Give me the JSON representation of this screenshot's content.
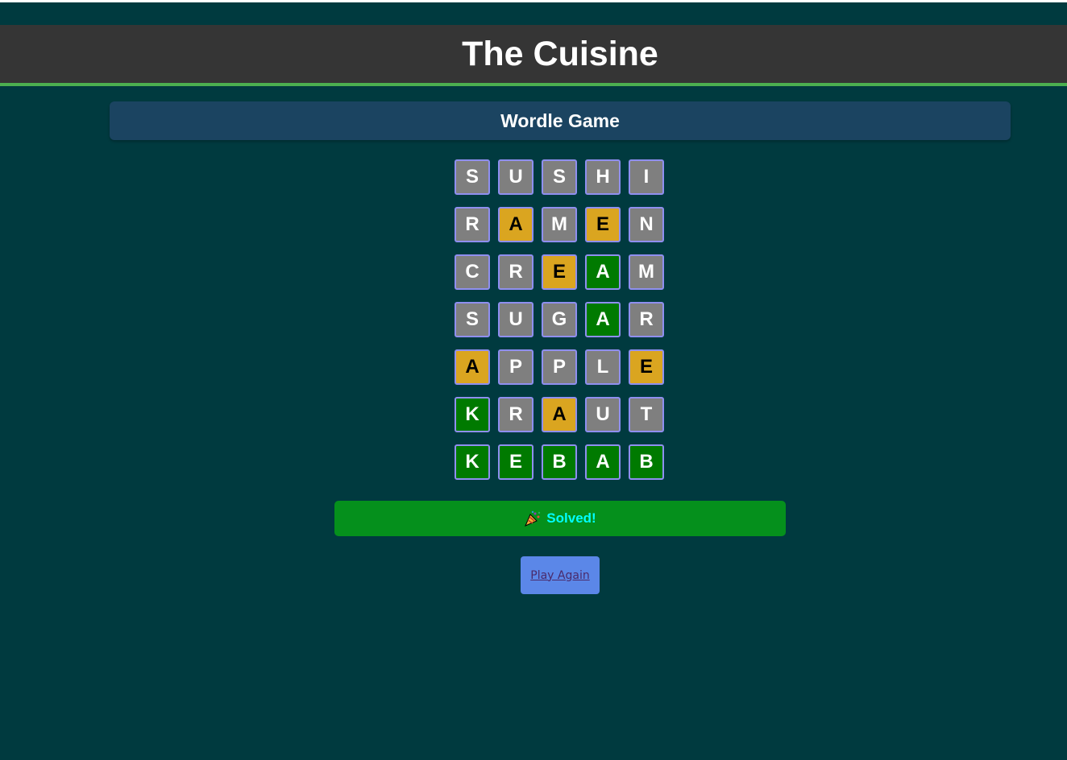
{
  "header": {
    "title": "The Cuisine"
  },
  "subheader": {
    "title": "Wordle Game"
  },
  "board": {
    "rows": [
      [
        {
          "letter": "S",
          "state": "absent"
        },
        {
          "letter": "U",
          "state": "absent"
        },
        {
          "letter": "S",
          "state": "absent"
        },
        {
          "letter": "H",
          "state": "absent"
        },
        {
          "letter": "I",
          "state": "absent"
        }
      ],
      [
        {
          "letter": "R",
          "state": "absent"
        },
        {
          "letter": "A",
          "state": "present"
        },
        {
          "letter": "M",
          "state": "absent"
        },
        {
          "letter": "E",
          "state": "present"
        },
        {
          "letter": "N",
          "state": "absent"
        }
      ],
      [
        {
          "letter": "C",
          "state": "absent"
        },
        {
          "letter": "R",
          "state": "absent"
        },
        {
          "letter": "E",
          "state": "present"
        },
        {
          "letter": "A",
          "state": "correct"
        },
        {
          "letter": "M",
          "state": "absent"
        }
      ],
      [
        {
          "letter": "S",
          "state": "absent"
        },
        {
          "letter": "U",
          "state": "absent"
        },
        {
          "letter": "G",
          "state": "absent"
        },
        {
          "letter": "A",
          "state": "correct"
        },
        {
          "letter": "R",
          "state": "absent"
        }
      ],
      [
        {
          "letter": "A",
          "state": "present"
        },
        {
          "letter": "P",
          "state": "absent"
        },
        {
          "letter": "P",
          "state": "absent"
        },
        {
          "letter": "L",
          "state": "absent"
        },
        {
          "letter": "E",
          "state": "present"
        }
      ],
      [
        {
          "letter": "K",
          "state": "correct"
        },
        {
          "letter": "R",
          "state": "absent"
        },
        {
          "letter": "A",
          "state": "present"
        },
        {
          "letter": "U",
          "state": "absent"
        },
        {
          "letter": "T",
          "state": "absent"
        }
      ],
      [
        {
          "letter": "K",
          "state": "correct"
        },
        {
          "letter": "E",
          "state": "correct"
        },
        {
          "letter": "B",
          "state": "correct"
        },
        {
          "letter": "A",
          "state": "correct"
        },
        {
          "letter": "B",
          "state": "correct"
        }
      ]
    ]
  },
  "status": {
    "icon": "party-popper-icon",
    "text": "Solved!"
  },
  "actions": {
    "play_again_label": "Play Again"
  },
  "colors": {
    "background": "#003a3f",
    "header_bg": "#353535",
    "header_accent": "#4caf50",
    "subheader_bg": "#1b4461",
    "absent": "#7f7f7f",
    "present": "#daa520",
    "correct": "#007a00",
    "status_bg": "#05901c",
    "status_text": "#00ffff",
    "button_bg": "#5b87e8"
  }
}
